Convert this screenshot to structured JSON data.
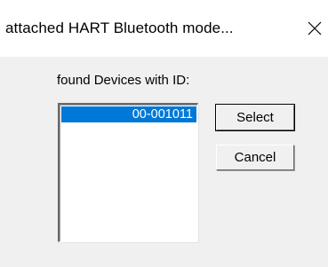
{
  "window": {
    "title": "attached HART Bluetooth mode...",
    "close_icon": "close-icon"
  },
  "dialog": {
    "found_label": "found Devices with ID:",
    "devices": [
      {
        "id": "00-001011",
        "selected": true
      }
    ],
    "select_label": "Select",
    "cancel_label": "Cancel"
  },
  "colors": {
    "selection": "#0078d7",
    "dialog_bg": "#f0f0f0",
    "titlebar_bg": "#ffffff"
  }
}
